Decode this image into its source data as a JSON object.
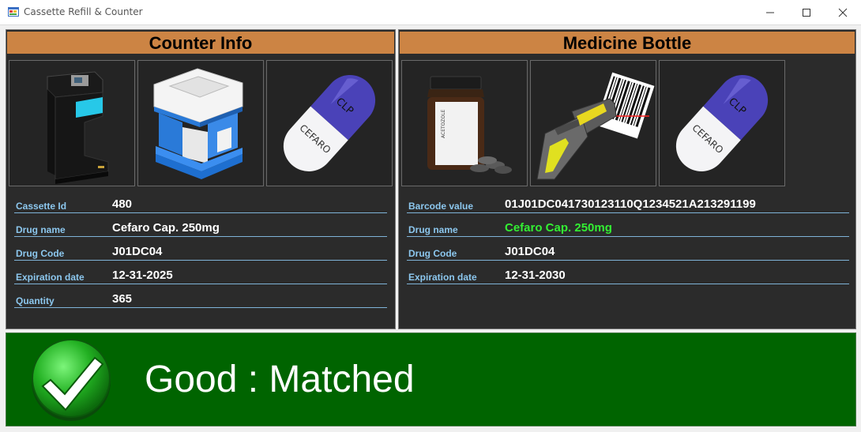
{
  "window": {
    "title": "Cassette Refill & Counter",
    "minimize_icon": "minimize-icon",
    "maximize_icon": "maximize-icon",
    "close_icon": "close-icon"
  },
  "counter_info": {
    "header": "Counter Info",
    "images": [
      "counting-machine-image",
      "cassette-image",
      "capsule-image"
    ],
    "fields": [
      {
        "label": "Cassette Id",
        "value": "480"
      },
      {
        "label": "Drug name",
        "value": "Cefaro Cap. 250mg"
      },
      {
        "label": "Drug Code",
        "value": "J01DC04"
      },
      {
        "label": "Expiration date",
        "value": "12-31-2025"
      },
      {
        "label": "Quantity",
        "value": "365"
      }
    ]
  },
  "medicine_bottle": {
    "header": "Medicine Bottle",
    "images": [
      "medicine-bottle-image",
      "barcode-scanner-image",
      "capsule-image"
    ],
    "fields": [
      {
        "label": "Barcode value",
        "value": "01J01DC041730123110Q1234521A213291199"
      },
      {
        "label": "Drug name",
        "value": "Cefaro Cap. 250mg"
      },
      {
        "label": "Drug Code",
        "value": "J01DC04"
      },
      {
        "label": "Expiration date",
        "value": "12-31-2030"
      }
    ]
  },
  "status": {
    "text": "Good : Matched",
    "icon": "checkmark-icon",
    "color": "#006400",
    "match_color": "#33ee33"
  },
  "colors": {
    "header_bg": "#cc8444",
    "panel_bg": "#2b2b2b",
    "label_color": "#8cc7ee"
  },
  "capsule_text": {
    "top": "CLP",
    "bottom": "CEFARO"
  },
  "bottle_label": "ACETOZOLE"
}
